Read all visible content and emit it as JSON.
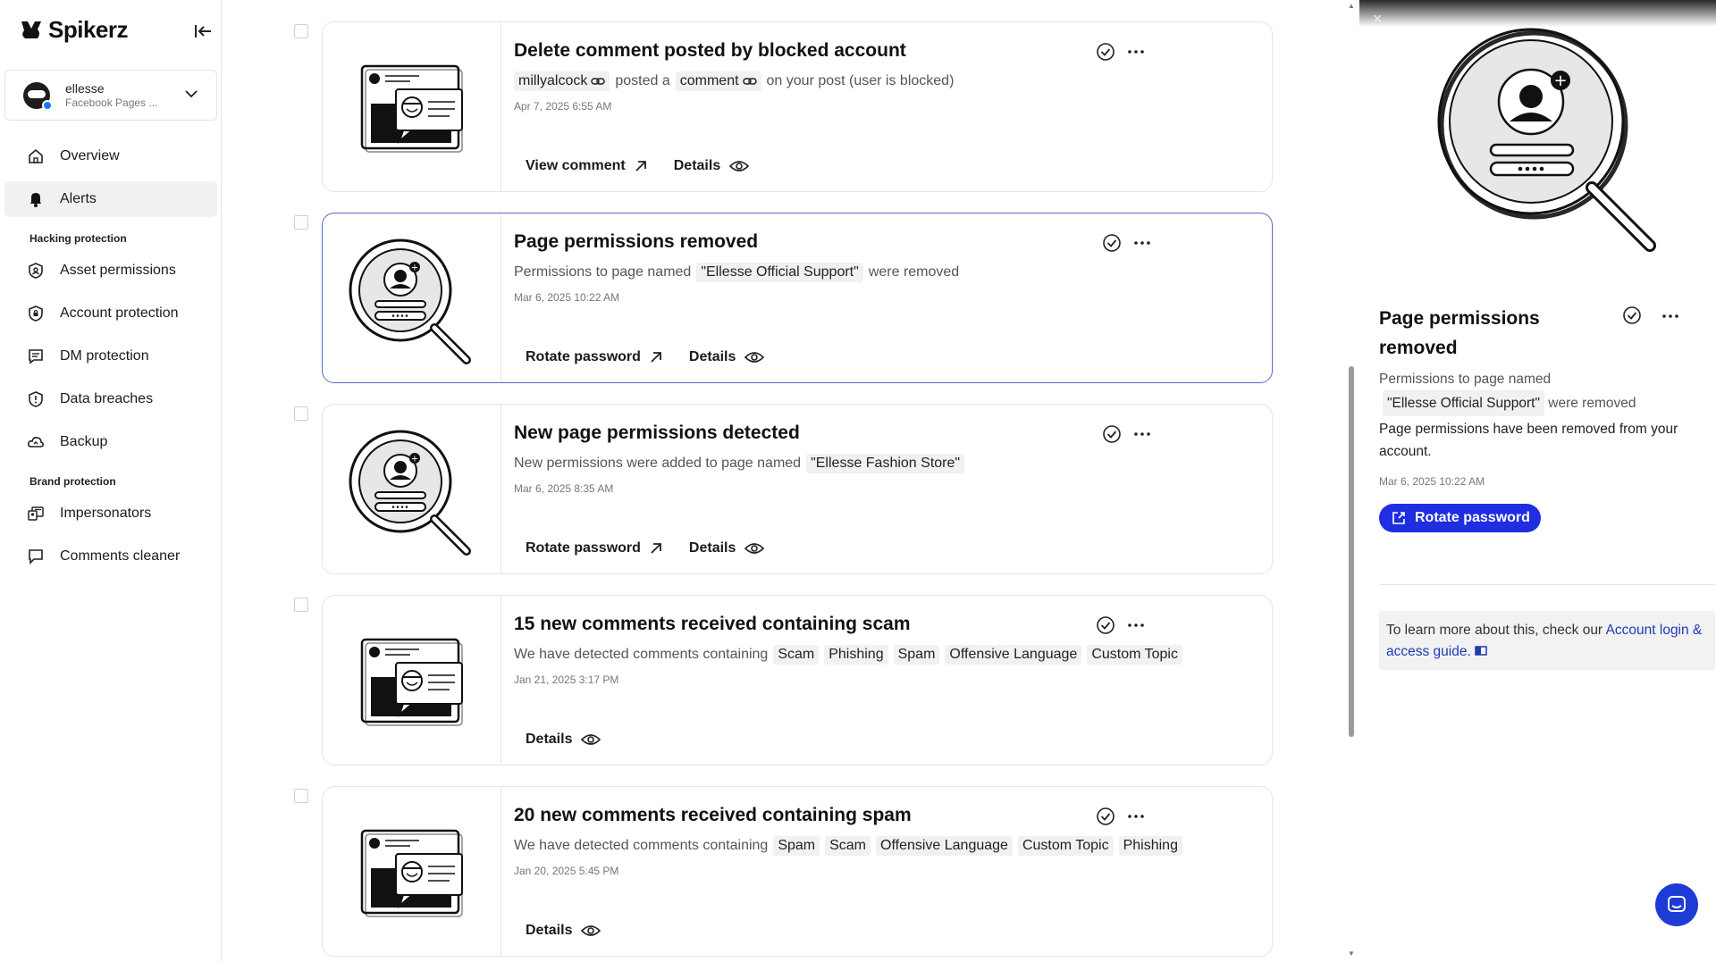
{
  "brand": {
    "name": "Spikerz"
  },
  "account": {
    "name": "ellesse",
    "subtitle": "Facebook Pages ..."
  },
  "nav": {
    "overview": "Overview",
    "alerts": "Alerts",
    "hacking_section": "Hacking protection",
    "asset_permissions": "Asset permissions",
    "account_protection": "Account protection",
    "dm_protection": "DM protection",
    "data_breaches": "Data breaches",
    "backup": "Backup",
    "brand_section": "Brand protection",
    "impersonators": "Impersonators",
    "comments_cleaner": "Comments cleaner"
  },
  "alerts": [
    {
      "title": "Delete comment posted by blocked account",
      "desc": {
        "user": "millyalcock",
        "mid": "posted a",
        "link": "comment",
        "tail": "on your post (user is blocked)"
      },
      "date": "Apr 7, 2025 6:55 AM",
      "actions": [
        "View comment",
        "Details"
      ],
      "illustration": "comment-scam"
    },
    {
      "title": "Page permissions removed",
      "desc": {
        "pre": "Permissions to page named",
        "chip": "\"Ellesse Official Support\"",
        "tail": "were removed"
      },
      "date": "Mar 6, 2025 10:22 AM",
      "actions": [
        "Rotate password",
        "Details"
      ],
      "illustration": "magnifier-user",
      "selected": true
    },
    {
      "title": "New page permissions detected",
      "desc": {
        "pre": "New permissions were added to page named",
        "chip": "\"Ellesse Fashion Store\""
      },
      "date": "Mar 6, 2025 8:35 AM",
      "actions": [
        "Rotate password",
        "Details"
      ],
      "illustration": "magnifier-user"
    },
    {
      "title": "15 new comments received containing scam",
      "desc": {
        "pre": "We have detected comments containing",
        "chips": [
          "Scam",
          "Phishing",
          "Spam",
          "Offensive Language",
          "Custom Topic"
        ]
      },
      "date": "Jan 21, 2025 3:17 PM",
      "actions": [
        "Details"
      ],
      "illustration": "comment-scam"
    },
    {
      "title": "20 new comments received containing spam",
      "desc": {
        "pre": "We have detected comments containing",
        "chips": [
          "Spam",
          "Scam",
          "Offensive Language",
          "Custom Topic",
          "Phishing"
        ]
      },
      "date": "Jan 20, 2025 5:45 PM",
      "actions": [
        "Details"
      ],
      "illustration": "comment-scam"
    }
  ],
  "panel": {
    "title": "Page permissions removed",
    "desc_pre": "Permissions to page named",
    "desc_chip": "\"Ellesse Official Support\"",
    "desc_tail": "were removed",
    "note": "Page permissions have been removed from your account.",
    "date": "Mar 6, 2025 10:22 AM",
    "button": "Rotate password",
    "info_pre": "To learn more about this, check our",
    "info_link": "Account login & access guide.",
    "close": "×"
  },
  "colors": {
    "accent": "#1f2ee0",
    "selected_border": "#5b6bc4",
    "chip_bg": "#f1f1f1"
  }
}
